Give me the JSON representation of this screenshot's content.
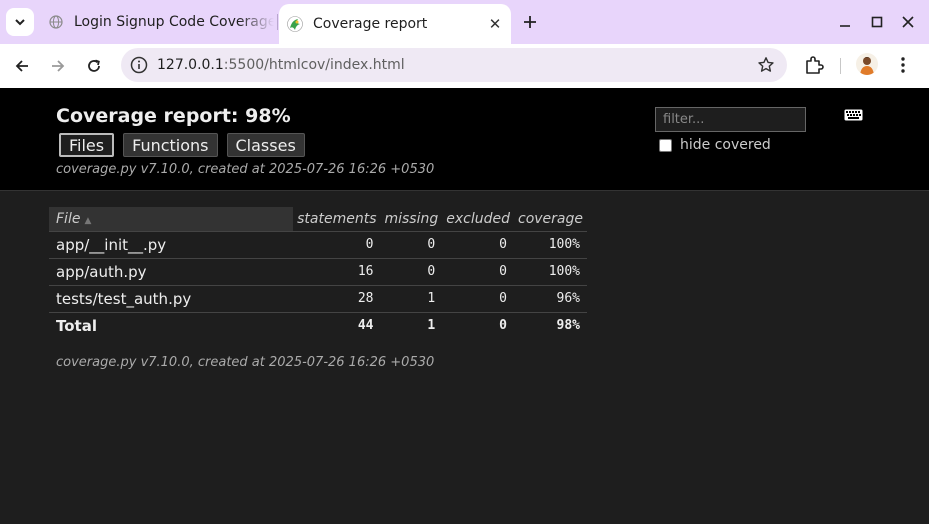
{
  "browser": {
    "tabs": [
      {
        "title": "Login Signup Code Coverage",
        "active": false
      },
      {
        "title": "Coverage report",
        "active": true
      }
    ],
    "url_host": "127.0.0.1",
    "url_path": ":5500/htmlcov/index.html",
    "accent": "#e8d5fb"
  },
  "report": {
    "title": "Coverage report: 98%",
    "nav": {
      "files": "Files",
      "functions": "Functions",
      "classes": "Classes"
    },
    "created": "coverage.py v7.10.0, created at 2025-07-26 16:26 +0530",
    "filter_placeholder": "filter...",
    "hide_covered": "hide covered",
    "columns": {
      "file": "File",
      "statements": "statements",
      "missing": "missing",
      "excluded": "excluded",
      "coverage": "coverage"
    },
    "rows": [
      {
        "file": "app/__init__.py",
        "statements": "0",
        "missing": "0",
        "excluded": "0",
        "coverage": "100%"
      },
      {
        "file": "app/auth.py",
        "statements": "16",
        "missing": "0",
        "excluded": "0",
        "coverage": "100%"
      },
      {
        "file": "tests/test_auth.py",
        "statements": "28",
        "missing": "1",
        "excluded": "0",
        "coverage": "96%"
      }
    ],
    "total": {
      "file": "Total",
      "statements": "44",
      "missing": "1",
      "excluded": "0",
      "coverage": "98%"
    },
    "footer": "coverage.py v7.10.0, created at 2025-07-26 16:26 +0530"
  }
}
